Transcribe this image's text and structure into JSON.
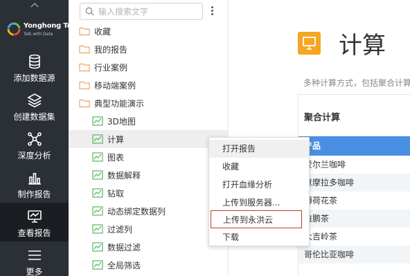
{
  "nav": {
    "logo_name": "Yonghong Tech",
    "logo_tagline": "Talk with Data",
    "items": [
      {
        "label": "添加数据源",
        "icon": "database-icon"
      },
      {
        "label": "创建数据集",
        "icon": "layers-icon"
      },
      {
        "label": "深度分析",
        "icon": "network-icon"
      },
      {
        "label": "制作报告",
        "icon": "bar-chart-icon"
      },
      {
        "label": "查看报告",
        "icon": "monitor-icon"
      },
      {
        "label": "更多",
        "icon": "menu-icon"
      }
    ]
  },
  "tree": {
    "search_placeholder": "输入搜索文字",
    "folders": [
      "收藏",
      "我的报告",
      "行业案例",
      "移动端案例",
      "典型功能演示"
    ],
    "reports": [
      "3D地图",
      "计算",
      "图表",
      "数据解释",
      "钻取",
      "动态绑定数据列",
      "过滤列",
      "数据过滤",
      "全局筛选"
    ]
  },
  "main": {
    "title": "计算",
    "description": "多种计算方式，包括聚合计算",
    "panel_title": "聚合计算",
    "table_header": "产品",
    "table_rows": [
      "爱尔兰咖啡",
      "意摩拉多咖啡",
      "薄荷花茶",
      "白鹏茶",
      "大吉岭茶",
      "哥伦比亚咖啡"
    ]
  },
  "context_menu": {
    "items": [
      "打开报告",
      "收藏",
      "打开血缘分析",
      "上传到服务器...",
      "上传到永洪云",
      "下载"
    ]
  },
  "colors": {
    "nav_bg": "#2b2f36",
    "accent_orange": "#f5a623",
    "table_header_blue": "#4a90e2",
    "folder_orange": "#f0a35e",
    "report_green": "#4caf50",
    "highlight_red": "#c0392b"
  }
}
